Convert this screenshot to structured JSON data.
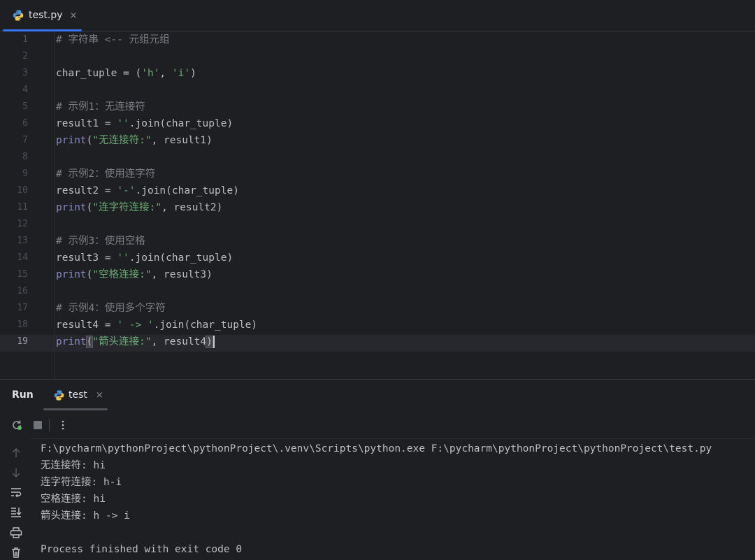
{
  "editor_tab": {
    "filename": "test.py",
    "close": "×"
  },
  "code_lines": [
    {
      "n": "1",
      "segments": [
        {
          "t": "# 字符串 <-- 元组元组",
          "c": "cmt"
        }
      ]
    },
    {
      "n": "2",
      "segments": []
    },
    {
      "n": "3",
      "segments": [
        {
          "t": "char_tuple = (",
          "c": ""
        },
        {
          "t": "'h'",
          "c": "str"
        },
        {
          "t": ", ",
          "c": ""
        },
        {
          "t": "'i'",
          "c": "str"
        },
        {
          "t": ")",
          "c": ""
        }
      ]
    },
    {
      "n": "4",
      "segments": []
    },
    {
      "n": "5",
      "segments": [
        {
          "t": "# 示例1：无连接符",
          "c": "cmt"
        }
      ]
    },
    {
      "n": "6",
      "segments": [
        {
          "t": "result1 = ",
          "c": ""
        },
        {
          "t": "''",
          "c": "str"
        },
        {
          "t": ".join(char_tuple)",
          "c": ""
        }
      ]
    },
    {
      "n": "7",
      "segments": [
        {
          "t": "print",
          "c": "kw"
        },
        {
          "t": "(",
          "c": ""
        },
        {
          "t": "\"无连接符:\"",
          "c": "str"
        },
        {
          "t": ", result1)",
          "c": ""
        }
      ]
    },
    {
      "n": "8",
      "segments": []
    },
    {
      "n": "9",
      "segments": [
        {
          "t": "# 示例2：使用连字符",
          "c": "cmt"
        }
      ]
    },
    {
      "n": "10",
      "segments": [
        {
          "t": "result2 = ",
          "c": ""
        },
        {
          "t": "'-'",
          "c": "str"
        },
        {
          "t": ".join(char_tuple)",
          "c": ""
        }
      ]
    },
    {
      "n": "11",
      "segments": [
        {
          "t": "print",
          "c": "kw"
        },
        {
          "t": "(",
          "c": ""
        },
        {
          "t": "\"连字符连接:\"",
          "c": "str"
        },
        {
          "t": ", result2)",
          "c": ""
        }
      ]
    },
    {
      "n": "12",
      "segments": []
    },
    {
      "n": "13",
      "segments": [
        {
          "t": "# 示例3：使用空格",
          "c": "cmt"
        }
      ]
    },
    {
      "n": "14",
      "segments": [
        {
          "t": "result3 = ",
          "c": ""
        },
        {
          "t": "''",
          "c": "str"
        },
        {
          "t": ".join(char_tuple)",
          "c": ""
        }
      ]
    },
    {
      "n": "15",
      "segments": [
        {
          "t": "print",
          "c": "kw"
        },
        {
          "t": "(",
          "c": ""
        },
        {
          "t": "\"空格连接:\"",
          "c": "str"
        },
        {
          "t": ", result3)",
          "c": ""
        }
      ]
    },
    {
      "n": "16",
      "segments": []
    },
    {
      "n": "17",
      "segments": [
        {
          "t": "# 示例4：使用多个字符",
          "c": "cmt"
        }
      ]
    },
    {
      "n": "18",
      "segments": [
        {
          "t": "result4 = ",
          "c": ""
        },
        {
          "t": "' -> '",
          "c": "str"
        },
        {
          "t": ".join(char_tuple)",
          "c": ""
        }
      ]
    },
    {
      "n": "19",
      "segments": [
        {
          "t": "print",
          "c": "kw"
        },
        {
          "t": "(",
          "c": "bracket"
        },
        {
          "t": "\"箭头连接:\"",
          "c": "str"
        },
        {
          "t": ", result4",
          "c": ""
        },
        {
          "t": ")",
          "c": "bracket"
        }
      ],
      "active": true
    }
  ],
  "run_panel": {
    "title": "Run",
    "tab_label": "test",
    "tab_close": "×",
    "toolbar": {
      "rerun_icon": "rerun-icon",
      "stop_icon": "stop-icon",
      "more_icon": "more-vertical-icon"
    },
    "sidebar_icons": [
      "arrow-up-icon",
      "arrow-down-icon",
      "soft-wrap-icon",
      "scroll-to-end-icon",
      "print-icon",
      "trash-icon"
    ]
  },
  "console_lines": [
    "F:\\pycharm\\pythonProject\\pythonProject\\.venv\\Scripts\\python.exe F:\\pycharm\\pythonProject\\pythonProject\\test.py",
    "无连接符: hi",
    "连字符连接: h-i",
    "空格连接: hi",
    "箭头连接: h -> i",
    "",
    "Process finished with exit code 0"
  ],
  "colors": {
    "accent": "#3574f0",
    "string": "#6aab73",
    "keyword": "#8888c6",
    "comment": "#7a7e85",
    "text": "#bcbec4"
  }
}
